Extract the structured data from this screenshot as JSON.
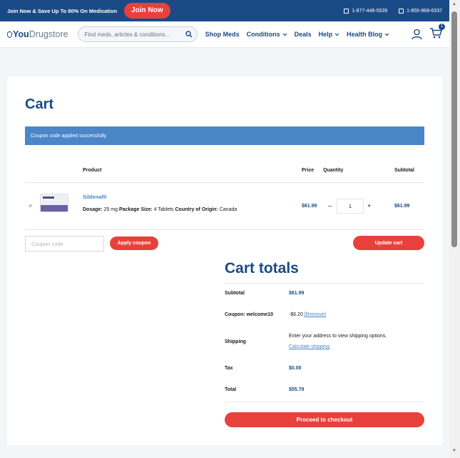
{
  "topbar": {
    "promo": "Join Now & Save Up To 80% On Medication",
    "join_button": "Join Now",
    "phone1": "1-877-448-5539",
    "phone2": "1-855-968-6337"
  },
  "header": {
    "logo_bold": "You",
    "logo_light": "Drugstore",
    "search_placeholder": "Find meds, articles & conditions...",
    "nav": [
      "Shop Meds",
      "Conditions",
      "Deals",
      "Help",
      "Health Blog"
    ],
    "cart_count": "1"
  },
  "cart": {
    "title": "Cart",
    "notice": "Coupon code applied successfully.",
    "headers": {
      "product": "Product",
      "price": "Price",
      "quantity": "Quantity",
      "subtotal": "Subtotal"
    },
    "item": {
      "remove": "×",
      "name": "Sildenafil",
      "dosage_label": "Dosage:",
      "dosage": "25 mg",
      "package_label": "Package Size:",
      "package": "4 Tablets",
      "origin_label": "Country of Origin:",
      "origin": "Canada",
      "price": "$61.99",
      "minus": "–",
      "quantity": "1",
      "plus": "+",
      "subtotal": "$61.99"
    },
    "coupon_placeholder": "Coupon code",
    "apply_button": "Apply coupon",
    "update_button": "Update cart"
  },
  "totals": {
    "title": "Cart totals",
    "subtotal_label": "Subtotal",
    "subtotal": "$61.99",
    "coupon_label": "Coupon: welcome10",
    "coupon_value": "-$6.20",
    "coupon_remove": "[Remove]",
    "shipping_label": "Shipping",
    "shipping_note": "Enter your address to view shipping options.",
    "shipping_link": "Calculate shipping",
    "tax_label": "Tax",
    "tax": "$0.00",
    "total_label": "Total",
    "total": "$55.79",
    "checkout_button": "Proceed to checkout"
  },
  "colors": {
    "brand_blue": "#1a4a86",
    "accent_red": "#e8413b",
    "notice_blue": "#4a86c8"
  }
}
